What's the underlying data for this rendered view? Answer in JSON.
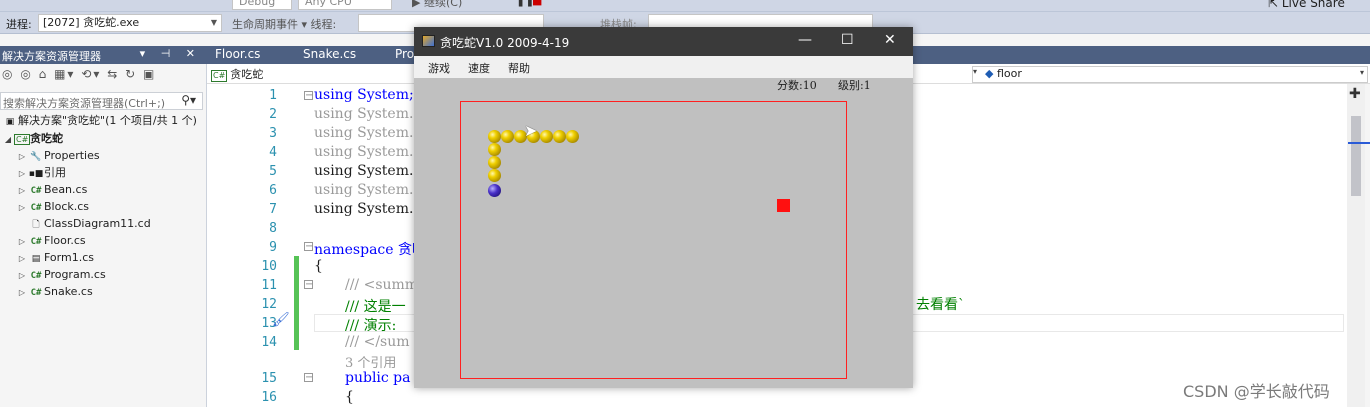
{
  "toolbar": {
    "debug_value": "Debug",
    "cpu_value": "Any CPU",
    "continue_label": "继续(C)",
    "live_share": "Live Share",
    "process_label": "进程:",
    "process_value": "[2072] 贪吃蛇.exe",
    "lifecycle_label": "生命周期事件 ▾ 线程:",
    "stack_label": "堆栈帧:"
  },
  "solution_explorer": {
    "title": "解决方案资源管理器",
    "header_controls": "▾ ⊣ ✕",
    "search_placeholder": "搜索解决方案资源管理器(Ctrl+;)",
    "items": [
      {
        "label": "解决方案\"贪吃蛇\"(1 个项目/共 1 个)",
        "icon": "solution-icon"
      },
      {
        "label": "贪吃蛇",
        "icon": "csharp-project-icon"
      },
      {
        "label": "Properties",
        "icon": "wrench-icon"
      },
      {
        "label": "引用",
        "icon": "references-icon"
      },
      {
        "label": "Bean.cs",
        "icon": "csharp-file-icon"
      },
      {
        "label": "Block.cs",
        "icon": "csharp-file-icon"
      },
      {
        "label": "ClassDiagram11.cd",
        "icon": "document-icon"
      },
      {
        "label": "Floor.cs",
        "icon": "csharp-file-icon"
      },
      {
        "label": "Form1.cs",
        "icon": "form-icon"
      },
      {
        "label": "Program.cs",
        "icon": "csharp-file-icon"
      },
      {
        "label": "Snake.cs",
        "icon": "csharp-file-icon"
      }
    ]
  },
  "editor": {
    "tabs": [
      "Floor.cs",
      "Snake.cs",
      "Pro"
    ],
    "nav_left": "贪吃蛇",
    "nav_right": "floor",
    "line_numbers": [
      "1",
      "2",
      "3",
      "4",
      "5",
      "6",
      "7",
      "8",
      "9",
      "10",
      "11",
      "12",
      "13",
      "14",
      "15",
      "16"
    ],
    "lines": {
      "l1": "using System;",
      "l2": "using System.",
      "l3": "using System.",
      "l4": "using System.",
      "l5": "using System.",
      "l6": "using System.",
      "l7": "using System.",
      "l9": "namespace 贪吃",
      "l10": "{",
      "l11": "/// <summ",
      "l12": "/// 这是一",
      "l13": "/// 演示:",
      "l14": "/// </sum",
      "refs": "3 个引用",
      "l15": "public pa",
      "l16": "{"
    },
    "right_fragment": "去看看`"
  },
  "game": {
    "title": "贪吃蛇V1.0 2009-4-19",
    "menus": [
      "游戏",
      "速度",
      "帮助"
    ],
    "score": "分数:10",
    "level": "级别:1"
  },
  "watermark": "CSDN @学长敲代码",
  "colors": {
    "accent": "#4d6082",
    "board_border": "#ff2020",
    "food": "#ff1010",
    "game_bg": "#c0c0c0"
  }
}
